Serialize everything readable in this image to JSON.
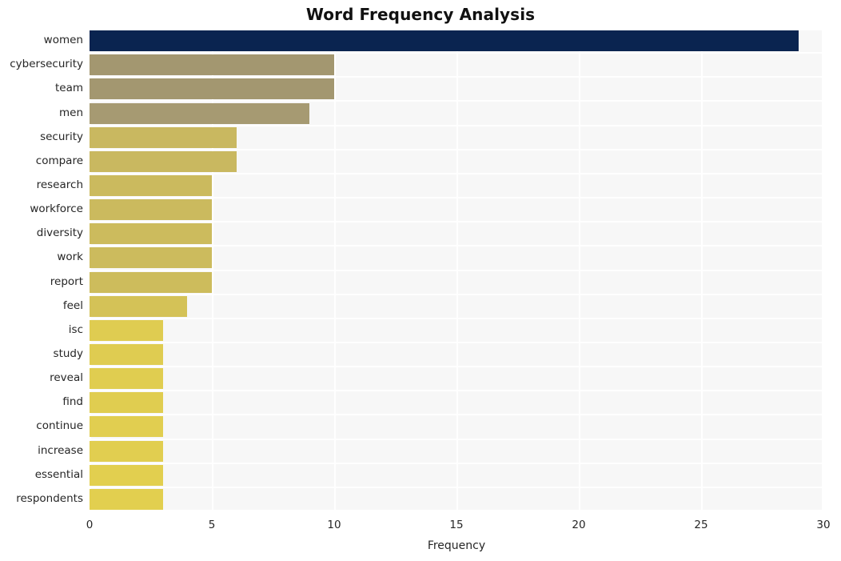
{
  "chart_data": {
    "type": "bar",
    "orientation": "horizontal",
    "title": "Word Frequency Analysis",
    "xlabel": "Frequency",
    "ylabel": "",
    "xlim": [
      0,
      30
    ],
    "xticks": [
      0,
      5,
      10,
      15,
      20,
      25,
      30
    ],
    "grid": true,
    "legend": false,
    "categories": [
      "women",
      "cybersecurity",
      "team",
      "men",
      "security",
      "compare",
      "research",
      "workforce",
      "diversity",
      "work",
      "report",
      "feel",
      "isc",
      "study",
      "reveal",
      "find",
      "continue",
      "increase",
      "essential",
      "respondents"
    ],
    "values": [
      29,
      10,
      10,
      9,
      6,
      6,
      5,
      5,
      5,
      5,
      5,
      4,
      3,
      3,
      3,
      3,
      3,
      3,
      3,
      3
    ],
    "bar_colors": [
      "#0a2450",
      "#a39770",
      "#a39770",
      "#a69a72",
      "#c9b860",
      "#c9b860",
      "#cbba5e",
      "#cbba5e",
      "#ccbb5d",
      "#ccbb5d",
      "#cdbc5c",
      "#d4c257",
      "#dfcc51",
      "#dfcc51",
      "#e0cd50",
      "#e0cd50",
      "#e1ce50",
      "#e1ce50",
      "#e2cf4f",
      "#e2cf4f"
    ]
  },
  "style": {
    "figure_background": "#ffffff",
    "plot_background": "#f7f7f7",
    "gridline_color": "#ffffff",
    "tick_label_color": "#262626",
    "title_color": "#111111"
  }
}
